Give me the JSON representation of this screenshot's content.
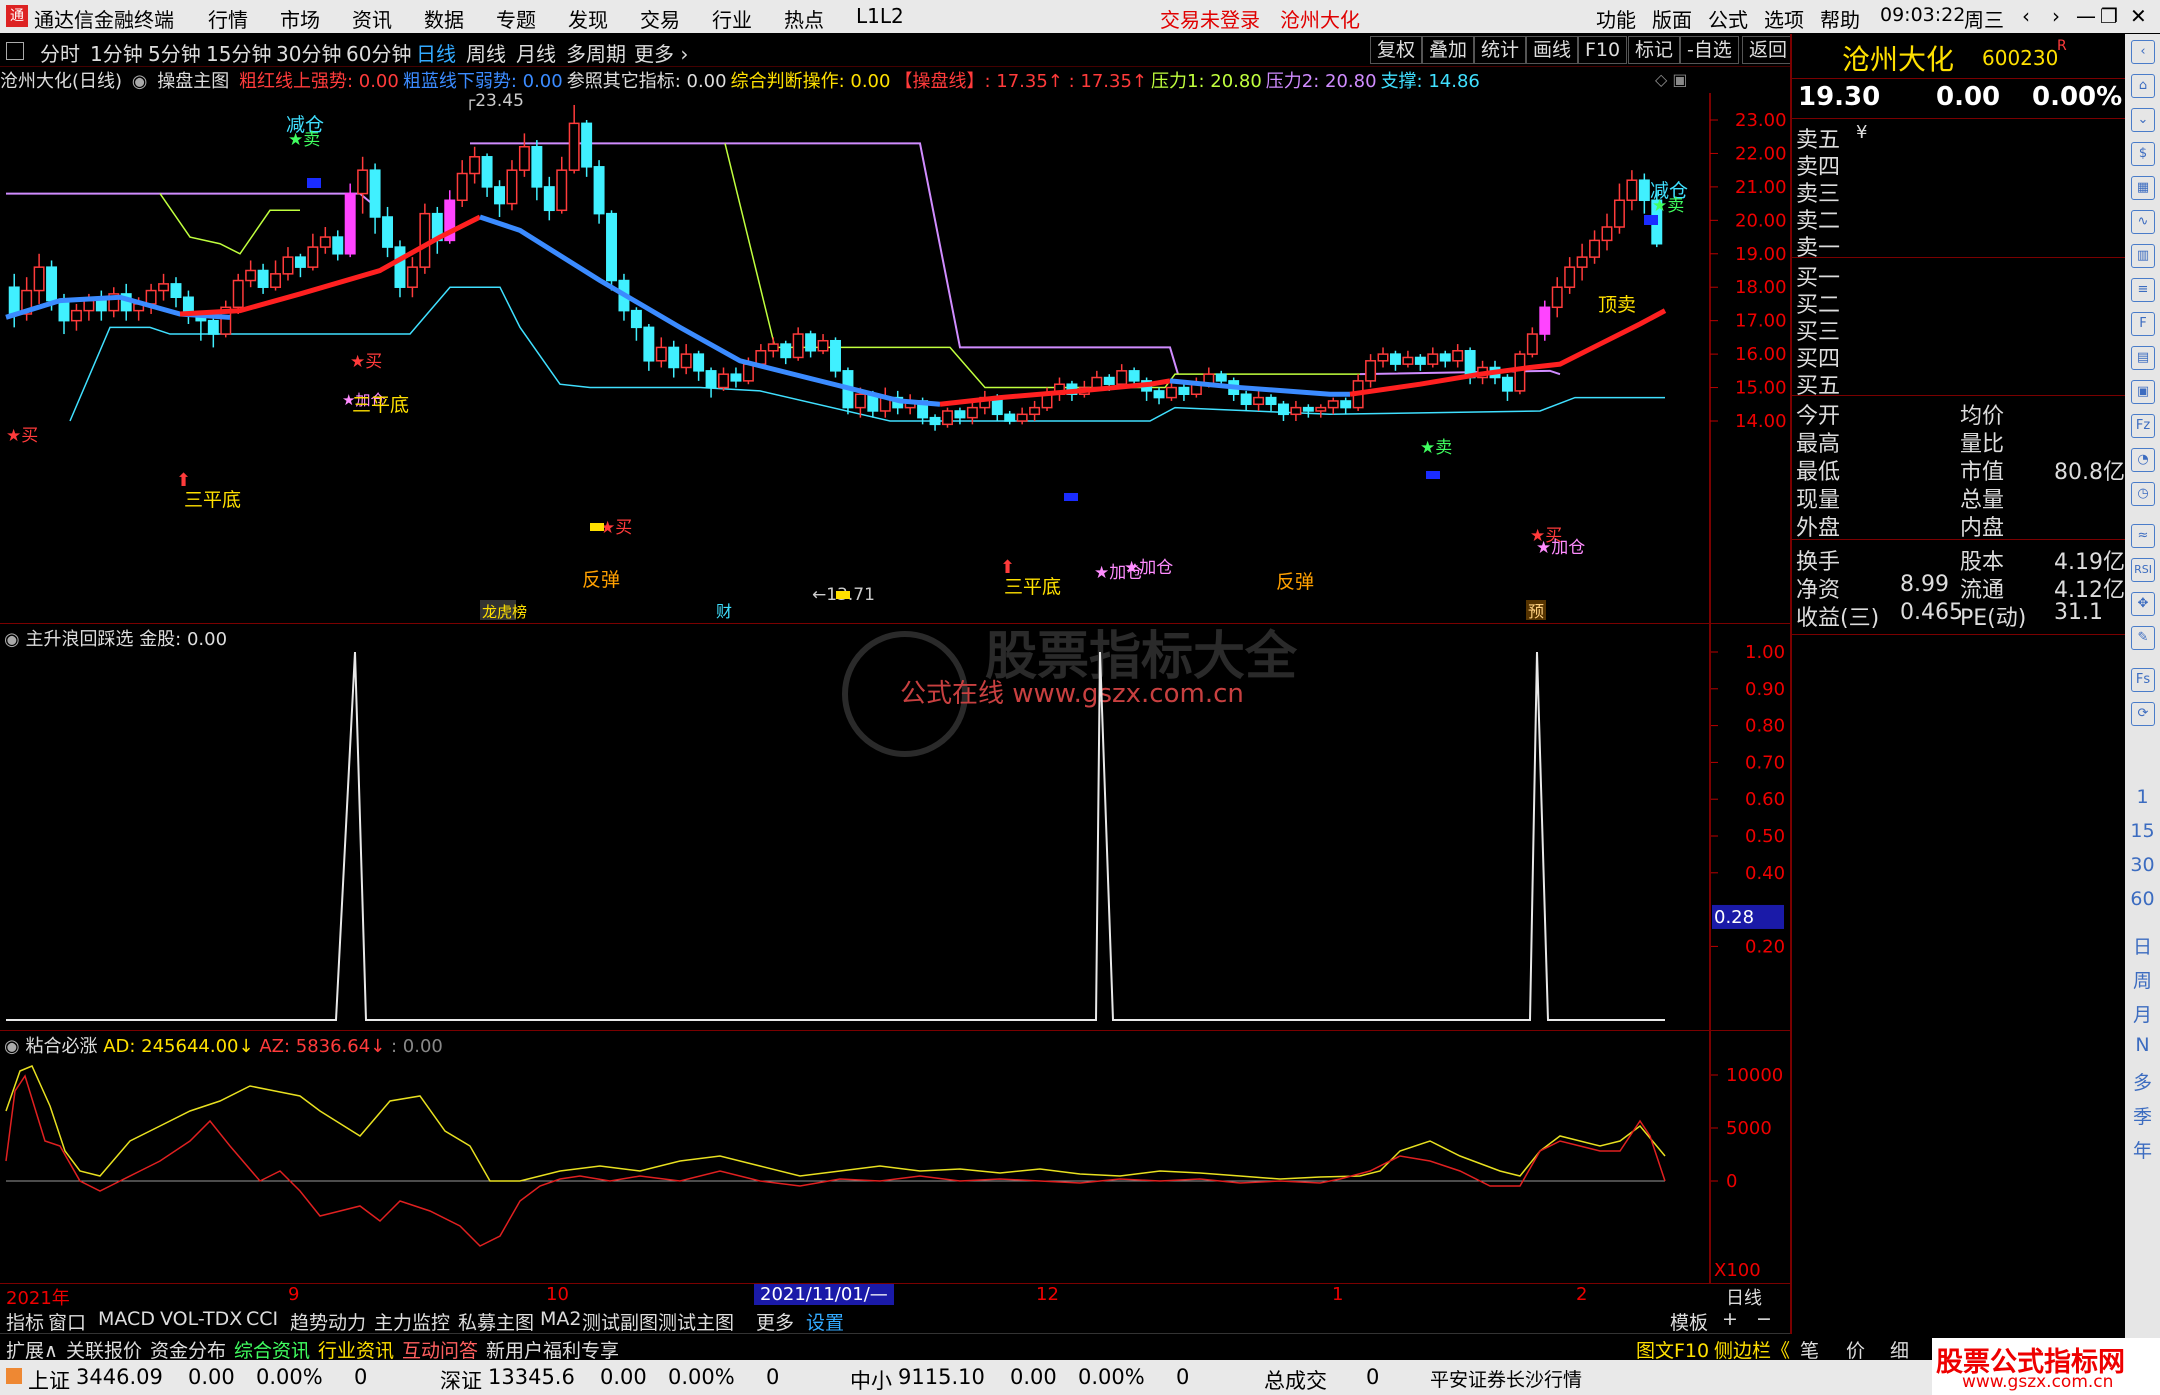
{
  "titlebar": {
    "app_title": "通达信金融终端",
    "menu": [
      "行情",
      "市场",
      "资讯",
      "数据",
      "专题",
      "发现",
      "交易",
      "行业",
      "热点",
      "L1L2"
    ],
    "login_status": "交易未登录",
    "stock_name": "沧州大化",
    "right_menu": [
      "功能",
      "版面",
      "公式",
      "选项",
      "帮助"
    ],
    "time": "09:03:22",
    "weekday": "周三"
  },
  "periodbar": {
    "periods": [
      "分时",
      "1分钟",
      "5分钟",
      "15分钟",
      "30分钟",
      "60分钟",
      "日线",
      "周线",
      "月线",
      "多周期",
      "更多"
    ],
    "selected_period": "日线",
    "buttons": [
      "复权",
      "叠加",
      "统计",
      "画线",
      "F10",
      "标记",
      "-自选",
      "返回"
    ]
  },
  "main_chart": {
    "stock_label": "沧州大化(日线)",
    "indicator": "操盘主图",
    "items": [
      {
        "text": "粗红线上强势: 0.00",
        "color": "#ff3b3b"
      },
      {
        "text": "粗蓝线下弱势: 0.00",
        "color": "#3b8bff"
      },
      {
        "text": "参照其它指标: 0.00",
        "color": "#dddddd"
      },
      {
        "text": "综合判断操作: 0.00",
        "color": "#ffe000"
      },
      {
        "text": "【操盘线】: 17.35↑ : 17.35↑",
        "color": "#ff3b3b"
      },
      {
        "text": "压力1: 20.80",
        "color": "#c0ff3e"
      },
      {
        "text": "压力2: 20.80",
        "color": "#d08cff"
      },
      {
        "text": "支撑: 14.86",
        "color": "#40e0ff"
      }
    ],
    "y_ticks": [
      "23.00",
      "22.00",
      "21.00",
      "20.00",
      "19.00",
      "18.00",
      "17.00",
      "16.00",
      "15.00",
      "14.00"
    ],
    "high_label": "23.45",
    "low_label": "13.71",
    "annotations": {
      "reduce1": "减仓",
      "sell1": "★卖",
      "buy1": "★买",
      "buy2": "★买",
      "buy3": "★买",
      "sanpingdi1": "三平底",
      "sanpingdi2": "三平底",
      "sanpingdi3": "三平底",
      "add1": "★加仓",
      "add2": "★加仓",
      "add3": "★加仓",
      "fantan1": "反弹",
      "fantan2": "反弹",
      "sell2": "★卖",
      "reduce2": "减仓",
      "sell3": "★卖",
      "dingmai": "顶卖",
      "buy4": "★买",
      "add4": "★加仓",
      "marker1": "龙虎榜",
      "marker2": "财",
      "marker3": "预"
    }
  },
  "sub_chart1": {
    "title": "主升浪回踩选",
    "value_label": "金股: 0.00",
    "y_ticks": [
      "1.00",
      "0.90",
      "0.80",
      "0.70",
      "0.60",
      "0.50",
      "0.40",
      "0.28",
      "0.20"
    ],
    "current_value": "0.28",
    "watermark1": "公式在线 www.gszx.com.cn",
    "watermark2": "股票指标大全"
  },
  "sub_chart2": {
    "title": "粘合必涨",
    "ad_label": "AD: 245644.00↓",
    "az_label": "AZ: 5836.64↓",
    "extra": ": 0.00",
    "y_ticks": [
      "10000",
      "5000",
      "0"
    ],
    "scale": "X100"
  },
  "x_axis": {
    "labels": [
      "2021年",
      "9",
      "10",
      "2021/11/01/—",
      "12",
      "1",
      "2"
    ],
    "period": "日线"
  },
  "tabbar1": [
    "指标",
    "窗口",
    "MACD",
    "VOL-TDX",
    "CCI",
    "趋势动力",
    "主力监控",
    "私募主图",
    "MA2",
    "测试副图",
    "测试主图",
    "更多",
    "设置"
  ],
  "tabbar1_right": [
    "模板",
    "+",
    "−"
  ],
  "tabbar2": [
    "扩展∧",
    "关联报价",
    "资金分布",
    "综合资讯",
    "行业资讯",
    "互动问答",
    "新用户福利专享"
  ],
  "tabbar2_right": [
    "图文F10",
    "侧边栏《",
    "笔",
    "价",
    "细"
  ],
  "right_panel": {
    "name": "沧州大化",
    "code": "600230",
    "badge": "R",
    "price": "19.30",
    "change": "0.00",
    "change_pct": "0.00%",
    "asks": [
      "卖五",
      "卖四",
      "卖三",
      "卖二",
      "卖一"
    ],
    "ask_unit": "¥",
    "bids": [
      "买一",
      "买二",
      "买三",
      "买四",
      "买五"
    ],
    "stats_left": [
      "今开",
      "最高",
      "最低",
      "现量",
      "外盘"
    ],
    "stats_mid": [
      "均价",
      "量比",
      "市值",
      "总量",
      "内盘"
    ],
    "market_cap": "80.8亿",
    "stats2": [
      {
        "l": "换手",
        "lv": "",
        "m": "股本",
        "mv": "4.19亿"
      },
      {
        "l": "净资",
        "lv": "8.99",
        "m": "流通",
        "mv": "4.12亿"
      },
      {
        "l": "收益(三)",
        "lv": "0.465",
        "m": "PE(动)",
        "mv": "31.1"
      }
    ]
  },
  "sidebar": [
    "1",
    "15",
    "30",
    "60",
    "日",
    "周",
    "月",
    "N",
    "多",
    "季",
    "年"
  ],
  "statusbar": {
    "items": [
      {
        "name": "上证",
        "val": "3446.09",
        "chg": "0.00",
        "pct": "0.00%",
        "vol": "0"
      },
      {
        "name": "深证",
        "val": "13345.6",
        "chg": "0.00",
        "pct": "0.00%",
        "vol": "0"
      },
      {
        "name": "中小",
        "val": "9115.10",
        "chg": "0.00",
        "pct": "0.00%",
        "vol": "0"
      }
    ],
    "total_label": "总成交",
    "total_val": "0",
    "broker": "平安证券长沙行情",
    "logo_text": "股票公式指标网",
    "logo_url": "www.gszx.com.cn"
  }
}
